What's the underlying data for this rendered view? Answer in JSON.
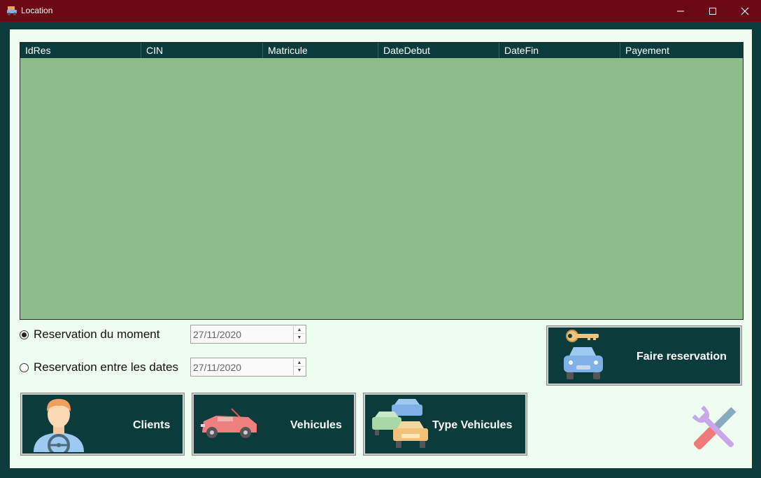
{
  "window": {
    "title": "Location"
  },
  "grid": {
    "columns": [
      "IdRes",
      "CIN",
      "Matricule",
      "DateDebut",
      "DateFin",
      "Payement"
    ]
  },
  "options": {
    "moment_label": "Reservation du moment",
    "dates_label": "Reservation entre les dates",
    "date1": "27/11/2020",
    "date2": "27/11/2020"
  },
  "buttons": {
    "faire_reservation": "Faire reservation",
    "clients": "Clients",
    "vehicules": "Vehicules",
    "type_vehicules": "Type Vehicules"
  },
  "colors": {
    "titlebar": "#6b0a14",
    "panel": "#0b3b3a",
    "grid_body": "#8fbc8b",
    "client_bg": "#eefdf0"
  }
}
